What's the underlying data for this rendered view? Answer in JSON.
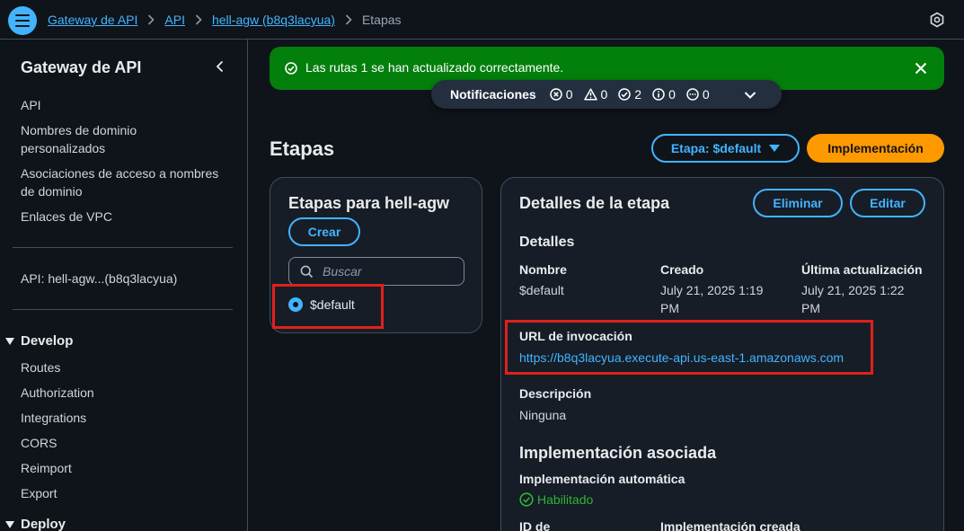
{
  "colors": {
    "accent": "#42b4ff",
    "primary": "#ff9900",
    "success_bg": "#037f0c",
    "success_text": "#2bb534",
    "highlight": "#e0201c"
  },
  "header": {
    "breadcrumb": [
      {
        "label": "Gateway de API",
        "link": true
      },
      {
        "label": "API",
        "link": true
      },
      {
        "label": "hell-agw (b8q3lacyua)",
        "link": true
      },
      {
        "label": "Etapas",
        "link": false
      }
    ]
  },
  "sidebar": {
    "title": "Gateway de API",
    "links": [
      "API",
      "Nombres de dominio personalizados",
      "Asociaciones de acceso a nombres de dominio",
      "Enlaces de VPC"
    ],
    "api_label": "API: hell-agw...(b8q3lacyua)",
    "develop": {
      "label": "Develop",
      "items": [
        "Routes",
        "Authorization",
        "Integrations",
        "CORS",
        "Reimport",
        "Export"
      ]
    },
    "deploy": {
      "label": "Deploy"
    }
  },
  "flash": {
    "message": "Las rutas 1 se han actualizado correctamente."
  },
  "notifications": {
    "label": "Notificaciones",
    "counts": {
      "error": "0",
      "warning": "0",
      "success": "2",
      "info": "0",
      "in_progress": "0"
    }
  },
  "main": {
    "title": "Etapas",
    "stage_select": "Etapa: $default",
    "deploy_button": "Implementación"
  },
  "stages_panel": {
    "title": "Etapas para hell-agw",
    "create_button": "Crear",
    "search_placeholder": "Buscar",
    "stages": [
      "$default"
    ]
  },
  "details_panel": {
    "title": "Detalles de la etapa",
    "delete_button": "Eliminar",
    "edit_button": "Editar",
    "details_heading": "Detalles",
    "name_label": "Nombre",
    "name_value": "$default",
    "created_label": "Creado",
    "created_value_line1": "July 21, 2025 1:19",
    "created_value_line2": "PM",
    "updated_label": "Última actualización",
    "updated_value_line1": "July 21, 2025 1:22",
    "updated_value_line2": "PM",
    "invoke_url_label": "URL de invocación",
    "invoke_url": "https://b8q3lacyua.execute-api.us-east-1.amazonaws.com",
    "description_label": "Descripción",
    "description_value": "Ninguna",
    "deployment_heading": "Implementación asociada",
    "auto_deploy_label": "Implementación automática",
    "auto_deploy_value": "Habilitado",
    "id_label": "ID de",
    "deploy_created_label": "Implementación creada"
  }
}
